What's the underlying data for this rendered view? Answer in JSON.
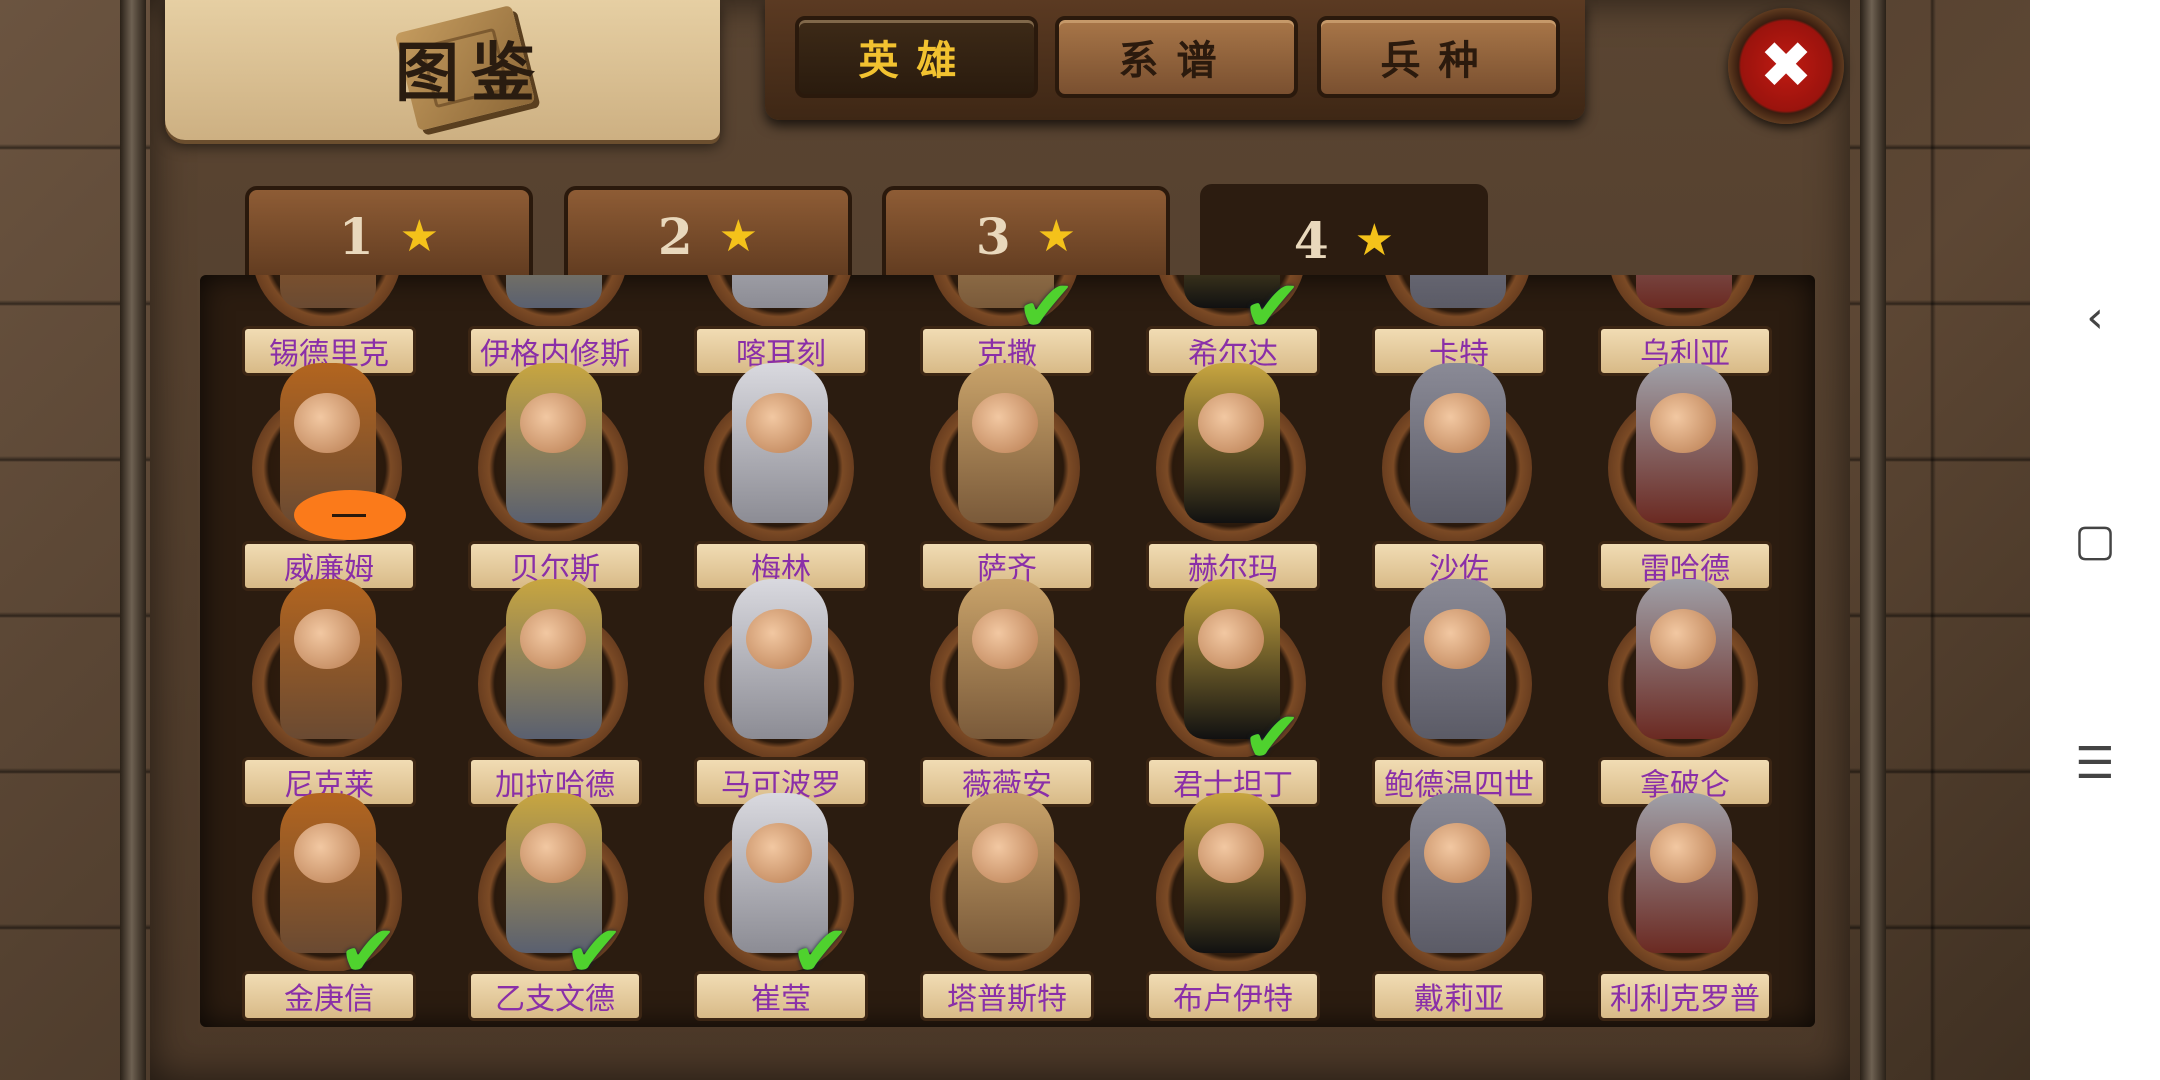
{
  "header": {
    "title": "图鉴"
  },
  "categories": [
    {
      "label": "英雄",
      "active": true
    },
    {
      "label": "系谱",
      "active": false
    },
    {
      "label": "兵种",
      "active": false
    }
  ],
  "close_icon": "close-x-icon",
  "star_tabs": [
    {
      "label": "1",
      "icon": "star-icon",
      "active": false
    },
    {
      "label": "2",
      "icon": "star-icon",
      "active": false
    },
    {
      "label": "3",
      "icon": "star-icon",
      "active": true
    },
    {
      "label": "4",
      "icon": "star-icon",
      "active": true
    }
  ],
  "heroes": [
    {
      "name": "锡德里克",
      "checked": false
    },
    {
      "name": "伊格内修斯",
      "checked": false
    },
    {
      "name": "喀耳刻",
      "checked": false
    },
    {
      "name": "克撒",
      "checked": true
    },
    {
      "name": "希尔达",
      "checked": true
    },
    {
      "name": "卡特",
      "checked": false
    },
    {
      "name": "乌利亚",
      "checked": false
    },
    {
      "name": "威廉姆",
      "checked": false
    },
    {
      "name": "贝尔斯",
      "checked": false
    },
    {
      "name": "梅林",
      "checked": false
    },
    {
      "name": "萨齐",
      "checked": false
    },
    {
      "name": "赫尔玛",
      "checked": false
    },
    {
      "name": "沙佐",
      "checked": false
    },
    {
      "name": "雷哈德",
      "checked": false
    },
    {
      "name": "尼克莱",
      "checked": false
    },
    {
      "name": "加拉哈德",
      "checked": false
    },
    {
      "name": "马可波罗",
      "checked": false
    },
    {
      "name": "薇薇安",
      "checked": false
    },
    {
      "name": "君士坦丁",
      "checked": true
    },
    {
      "name": "鲍德温四世",
      "checked": false
    },
    {
      "name": "拿破仑",
      "checked": false
    },
    {
      "name": "金庚信",
      "checked": true
    },
    {
      "name": "乙支文德",
      "checked": true
    },
    {
      "name": "崔莹",
      "checked": true
    },
    {
      "name": "塔普斯特",
      "checked": false
    },
    {
      "name": "布卢伊特",
      "checked": false
    },
    {
      "name": "戴莉亚",
      "checked": false
    },
    {
      "name": "利利克罗普",
      "checked": false
    }
  ],
  "nav": {
    "back_icon": "back-chevron-icon",
    "home_icon": "home-square-icon",
    "menu_icon": "menu-lines-icon"
  }
}
